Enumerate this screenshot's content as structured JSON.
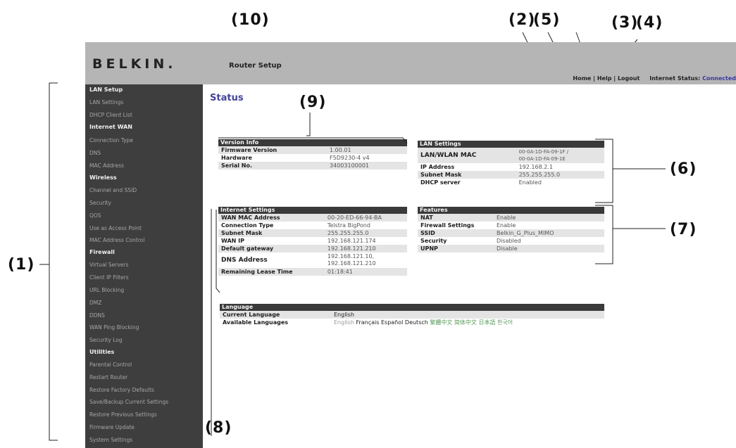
{
  "callouts": {
    "c10": "(10)",
    "c2": "(2)",
    "c5": "(5)",
    "c3": "(3)",
    "c4": "(4)",
    "c9": "(9)",
    "c6": "(6)",
    "c7": "(7)",
    "c1": "(1)",
    "c8": "(8)"
  },
  "header": {
    "logo": "BELKIN.",
    "router_setup": "Router Setup",
    "home": "Home",
    "help": "Help",
    "logout": "Logout",
    "sep": "|",
    "internet_status_label": "Internet Status:",
    "internet_status_value": "Connected"
  },
  "sidebar": {
    "items": [
      {
        "label": "LAN Setup",
        "head": true
      },
      {
        "label": "LAN Settings"
      },
      {
        "label": "DHCP Client List"
      },
      {
        "label": "Internet WAN",
        "head": true
      },
      {
        "label": "Connection Type"
      },
      {
        "label": "DNS"
      },
      {
        "label": "MAC Address"
      },
      {
        "label": "Wireless",
        "head": true
      },
      {
        "label": "Channel and SSID"
      },
      {
        "label": "Security"
      },
      {
        "label": "QOS"
      },
      {
        "label": "Use as Access Point"
      },
      {
        "label": "MAC Address Control"
      },
      {
        "label": "Firewall",
        "head": true
      },
      {
        "label": "Virtual Servers"
      },
      {
        "label": "Client IP Filters"
      },
      {
        "label": "URL Blocking"
      },
      {
        "label": "DMZ"
      },
      {
        "label": "DDNS"
      },
      {
        "label": "WAN Ping Blocking"
      },
      {
        "label": "Security Log"
      },
      {
        "label": "Utilities",
        "head": true
      },
      {
        "label": "Parental Control"
      },
      {
        "label": "Restart Router"
      },
      {
        "label": "Restore Factory Defaults"
      },
      {
        "label": "Save/Backup Current Settings"
      },
      {
        "label": "Restore Previous Settings"
      },
      {
        "label": "Firmware Update"
      },
      {
        "label": "System Settings"
      }
    ]
  },
  "main": {
    "title": "Status",
    "version_info": {
      "title": "Version Info",
      "rows": [
        {
          "k": "Firmware Version",
          "v": "1.00.01"
        },
        {
          "k": "Hardware",
          "v": "F5D9230-4 v4"
        },
        {
          "k": "Serial No.",
          "v": "34003100001"
        }
      ]
    },
    "lan_settings": {
      "title": "LAN Settings",
      "rows": [
        {
          "k": "LAN/WLAN MAC",
          "v": "00-0A-1D-FA-09-1F /",
          "v2": "00-0A-1D-FA-09-1E"
        },
        {
          "k": "IP Address",
          "v": "192.168.2.1"
        },
        {
          "k": "Subnet Mask",
          "v": "255.255.255.0"
        },
        {
          "k": "DHCP server",
          "v": "Enabled"
        }
      ]
    },
    "internet_settings": {
      "title": "Internet Settings",
      "rows": [
        {
          "k": "WAN MAC Address",
          "v": "00-20-ED-66-94-BA"
        },
        {
          "k": "Connection Type",
          "v": "Telstra BigPond"
        },
        {
          "k": "Subnet Mask",
          "v": "255.255.255.0"
        },
        {
          "k": "WAN IP",
          "v": "192.168.121.174"
        },
        {
          "k": "Default gateway",
          "v": "192.168.121.210"
        },
        {
          "k": "DNS Address",
          "v": "192.168.121.10,",
          "v2": "192.168.121.210"
        },
        {
          "k": "Remaining Lease Time",
          "v": "01:18:41"
        }
      ]
    },
    "features": {
      "title": "Features",
      "rows": [
        {
          "k": "NAT",
          "v": "Enable"
        },
        {
          "k": "Firewall Settings",
          "v": "Enable"
        },
        {
          "k": "SSID",
          "v": "Belkin_G_Plus_MIMO"
        },
        {
          "k": "Security",
          "v": "Disabled"
        },
        {
          "k": "UPNP",
          "v": "Disable"
        }
      ]
    },
    "language": {
      "title": "Language",
      "current_label": "Current Language",
      "current_value": "English",
      "available_label": "Available Languages",
      "available": [
        "English",
        "Français",
        "Español",
        "Deutsch",
        "繁體中文",
        "简体中文",
        "日本語",
        "한국어"
      ]
    }
  }
}
